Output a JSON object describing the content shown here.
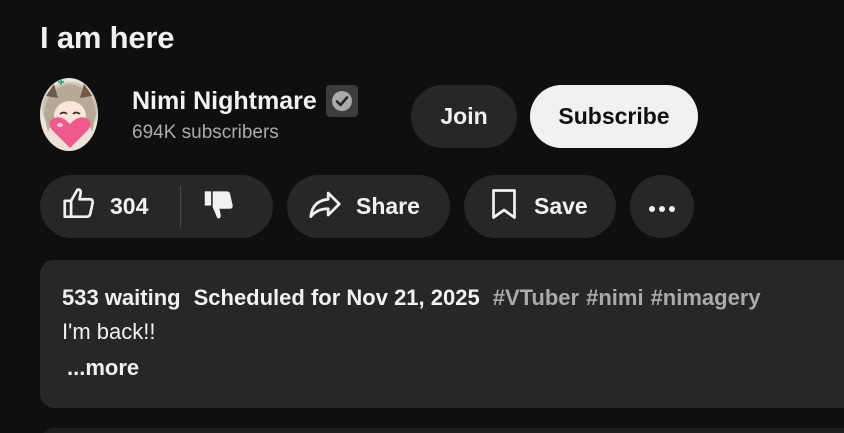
{
  "video": {
    "title": "I am here"
  },
  "channel": {
    "name": "Nimi Nightmare",
    "subscribers": "694K subscribers",
    "avatar_icon": "channel-avatar",
    "verified_icon": "verified-check-icon"
  },
  "buttons": {
    "join": "Join",
    "subscribe": "Subscribe",
    "share": "Share",
    "save": "Save"
  },
  "actions": {
    "like_count": "304",
    "like_icon": "thumbs-up-icon",
    "dislike_icon": "thumbs-down-icon",
    "share_icon": "share-arrow-icon",
    "save_icon": "bookmark-icon",
    "more_icon": "more-horizontal-icon"
  },
  "description": {
    "waiting": "533 waiting",
    "scheduled": "Scheduled for Nov 21, 2025",
    "hashtags": [
      "#VTuber",
      "#nimi",
      "#nimagery"
    ],
    "text": "I'm back!!",
    "more_label": "...more"
  },
  "colors": {
    "background": "#0f0f0f",
    "pill": "#272727",
    "subscribe_bg": "#f1f1f1",
    "text": "#f1f1f1",
    "secondary_text": "#aaaaaa"
  }
}
